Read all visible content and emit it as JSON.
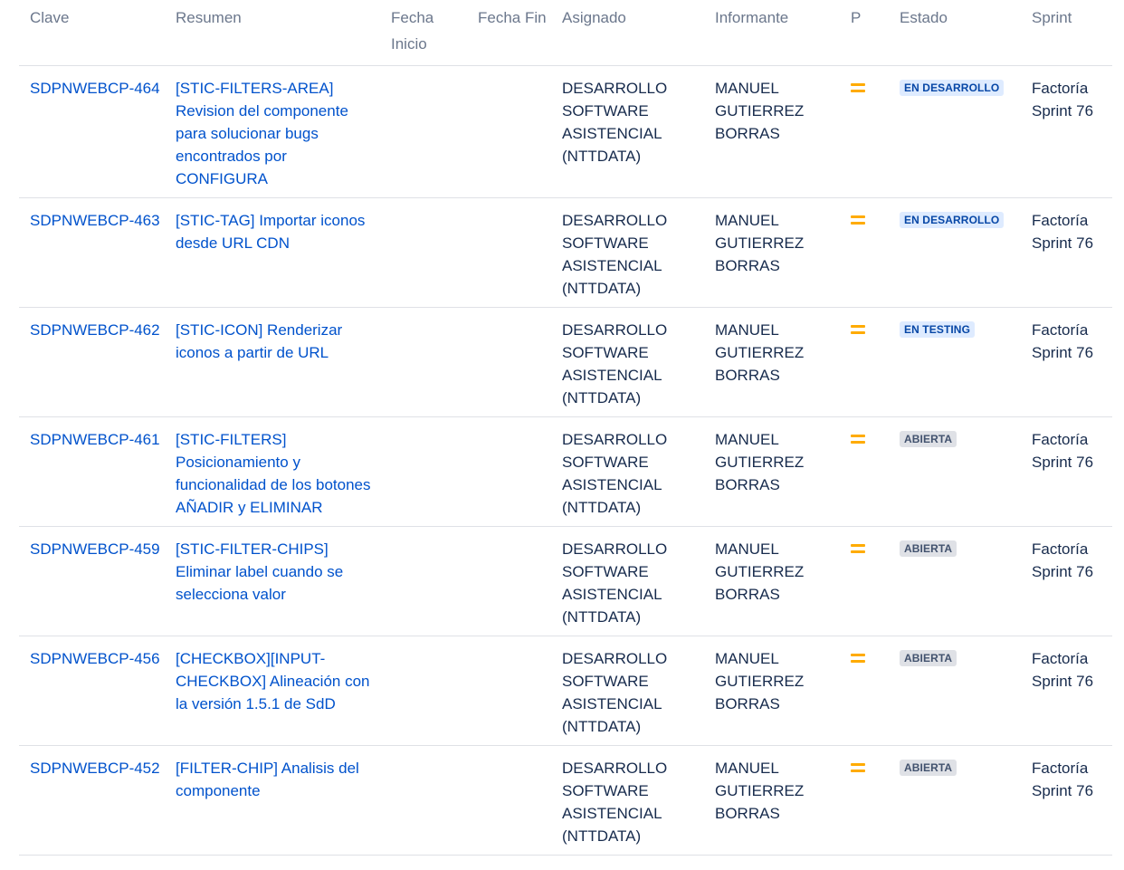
{
  "columns": {
    "key": "Clave",
    "summary": "Resumen",
    "start": "Fecha Inicio",
    "end": "Fecha Fin",
    "assignee": "Asignado",
    "reporter": "Informante",
    "priority": "P",
    "status": "Estado",
    "sprint": "Sprint"
  },
  "colors": {
    "link": "#0052cc",
    "priority_medium": "#ffab00",
    "status_in_progress_bg": "#deebff",
    "status_in_progress_fg": "#0747a6",
    "status_open_bg": "#dfe1e6",
    "status_open_fg": "#42526e"
  },
  "rows": [
    {
      "key": "SDPNWEBCP-464",
      "summary": "[STIC-FILTERS-AREA] Revision del componente para solucionar bugs encontrados por CONFIGURA",
      "start": "",
      "end": "",
      "assignee": "DESARROLLO SOFTWARE ASISTENCIAL (NTTDATA)",
      "reporter": "MANUEL GUTIERREZ BORRAS",
      "priority_icon": "priority-medium-icon",
      "status": "EN DESARROLLO",
      "status_color": "blue",
      "sprint": "Factoría Sprint 76"
    },
    {
      "key": "SDPNWEBCP-463",
      "summary": "[STIC-TAG] Importar iconos desde URL CDN",
      "start": "",
      "end": "",
      "assignee": "DESARROLLO SOFTWARE ASISTENCIAL (NTTDATA)",
      "reporter": "MANUEL GUTIERREZ BORRAS",
      "priority_icon": "priority-medium-icon",
      "status": "EN DESARROLLO",
      "status_color": "blue",
      "sprint": "Factoría Sprint 76"
    },
    {
      "key": "SDPNWEBCP-462",
      "summary": "[STIC-ICON] Renderizar iconos a partir de URL",
      "start": "",
      "end": "",
      "assignee": "DESARROLLO SOFTWARE ASISTENCIAL (NTTDATA)",
      "reporter": "MANUEL GUTIERREZ BORRAS",
      "priority_icon": "priority-medium-icon",
      "status": "EN TESTING",
      "status_color": "blue",
      "sprint": "Factoría Sprint 76"
    },
    {
      "key": "SDPNWEBCP-461",
      "summary": "[STIC-FILTERS] Posicionamiento y funcionalidad de los botones AÑADIR y ELIMINAR",
      "start": "",
      "end": "",
      "assignee": "DESARROLLO SOFTWARE ASISTENCIAL (NTTDATA)",
      "reporter": "MANUEL GUTIERREZ BORRAS",
      "priority_icon": "priority-medium-icon",
      "status": "ABIERTA",
      "status_color": "grey",
      "sprint": "Factoría Sprint 76"
    },
    {
      "key": "SDPNWEBCP-459",
      "summary": "[STIC-FILTER-CHIPS] Eliminar label cuando se selecciona valor",
      "start": "",
      "end": "",
      "assignee": "DESARROLLO SOFTWARE ASISTENCIAL (NTTDATA)",
      "reporter": "MANUEL GUTIERREZ BORRAS",
      "priority_icon": "priority-medium-icon",
      "status": "ABIERTA",
      "status_color": "grey",
      "sprint": "Factoría Sprint 76"
    },
    {
      "key": "SDPNWEBCP-456",
      "summary": "[CHECKBOX][INPUT-CHECKBOX] Alineación con la versión 1.5.1 de SdD",
      "start": "",
      "end": "",
      "assignee": "DESARROLLO SOFTWARE ASISTENCIAL (NTTDATA)",
      "reporter": "MANUEL GUTIERREZ BORRAS",
      "priority_icon": "priority-medium-icon",
      "status": "ABIERTA",
      "status_color": "grey",
      "sprint": "Factoría Sprint 76"
    },
    {
      "key": "SDPNWEBCP-452",
      "summary": "[FILTER-CHIP] Analisis del componente",
      "start": "",
      "end": "",
      "assignee": "DESARROLLO SOFTWARE ASISTENCIAL (NTTDATA)",
      "reporter": "MANUEL GUTIERREZ BORRAS",
      "priority_icon": "priority-medium-icon",
      "status": "ABIERTA",
      "status_color": "grey",
      "sprint": "Factoría Sprint 76"
    }
  ]
}
